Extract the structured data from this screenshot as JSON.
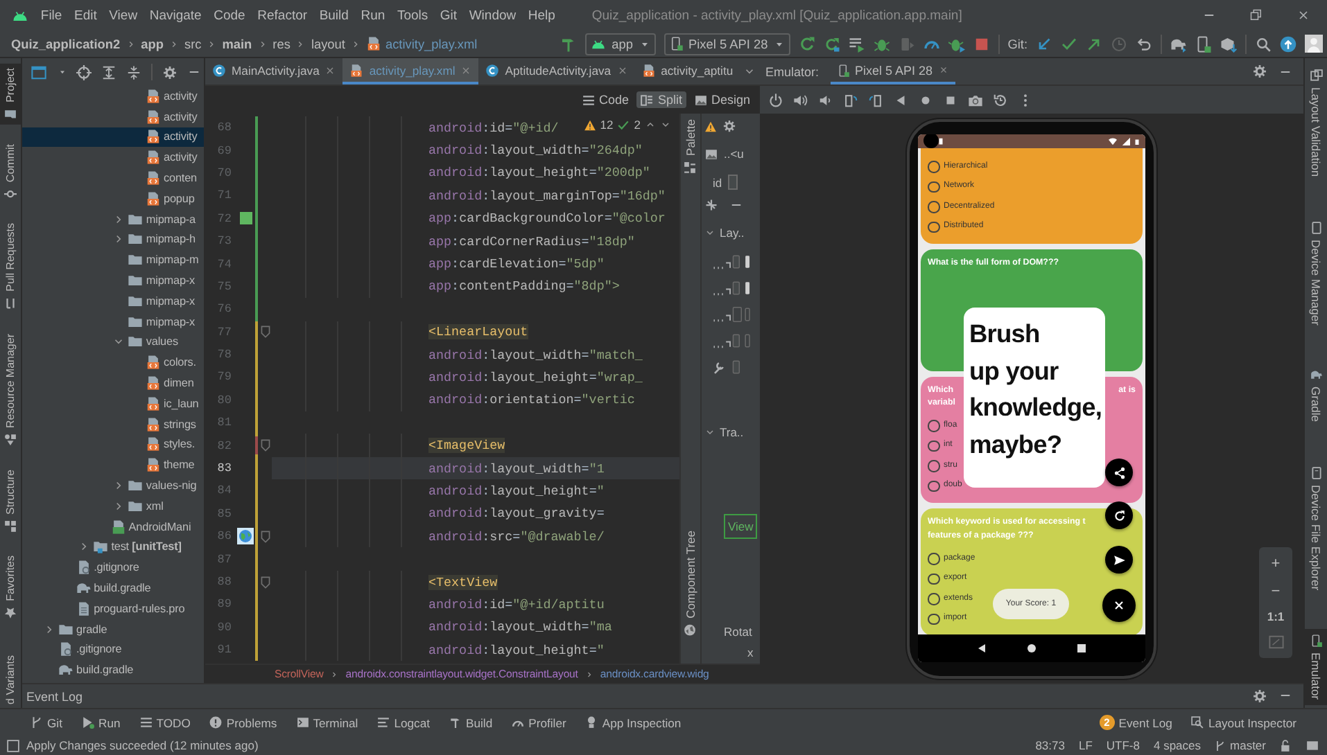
{
  "menu": {
    "items": [
      "File",
      "Edit",
      "View",
      "Navigate",
      "Code",
      "Refactor",
      "Build",
      "Run",
      "Tools",
      "Git",
      "Window",
      "Help"
    ],
    "title": "Quiz_application - activity_play.xml [Quiz_application.app.main]"
  },
  "breadcrumb": [
    {
      "label": "Quiz_application2",
      "kind": "module"
    },
    {
      "label": "app",
      "kind": "module"
    },
    {
      "label": "src",
      "kind": "dir"
    },
    {
      "label": "main",
      "kind": "module"
    },
    {
      "label": "res",
      "kind": "dir"
    },
    {
      "label": "layout",
      "kind": "dir"
    },
    {
      "label": "activity_play.xml",
      "kind": "file"
    }
  ],
  "toolbar": {
    "run_config": "app",
    "device": "Pixel 5 API 28",
    "git_label": "Git:"
  },
  "left_strip": [
    {
      "label": "Project",
      "kind": "project",
      "selected": true
    },
    {
      "label": "Commit",
      "kind": "commit",
      "selected": false
    },
    {
      "label": "Pull Requests",
      "kind": "pull",
      "selected": false
    },
    {
      "label": "Resource Manager",
      "kind": "resources",
      "selected": false
    },
    {
      "label": "Structure",
      "kind": "structure",
      "selected": false
    },
    {
      "label": "Favorites",
      "kind": "favorites",
      "selected": false
    },
    {
      "label": "d Variants",
      "kind": "cut",
      "selected": false
    }
  ],
  "project_tree": [
    {
      "children": [
        {
          "children": [
            {
              "children": [
                {
                  "children": [
                    {
                      "children": [
                        {
                          "label": "activity",
                          "kind": "xml",
                          "selected": false
                        },
                        {
                          "label": "activity",
                          "kind": "xml",
                          "selected": false
                        },
                        {
                          "label": "activity",
                          "kind": "xml",
                          "selected": true
                        },
                        {
                          "label": "activity",
                          "kind": "xml",
                          "selected": false
                        },
                        {
                          "label": "conten",
                          "kind": "xml",
                          "selected": false
                        },
                        {
                          "label": "popup",
                          "kind": "xml",
                          "selected": false
                        }
                      ]
                    },
                    {
                      "label": "mipmap-a",
                      "kind": "folder",
                      "expanded": false,
                      "selected": false
                    },
                    {
                      "label": "mipmap-h",
                      "kind": "folder",
                      "expanded": false,
                      "selected": false
                    },
                    {
                      "label": "mipmap-m",
                      "kind": "folder",
                      "selected": false
                    },
                    {
                      "label": "mipmap-x",
                      "kind": "folder",
                      "selected": false
                    },
                    {
                      "label": "mipmap-x",
                      "kind": "folder",
                      "selected": false
                    },
                    {
                      "label": "mipmap-x",
                      "kind": "folder",
                      "selected": false
                    },
                    {
                      "label": "values",
                      "kind": "folder",
                      "expanded": true,
                      "selected": false,
                      "children": [
                        {
                          "label": "colors.",
                          "kind": "xml",
                          "selected": false
                        },
                        {
                          "label": "dimen",
                          "kind": "xml",
                          "selected": false
                        },
                        {
                          "label": "ic_laun",
                          "kind": "xml",
                          "selected": false
                        },
                        {
                          "label": "strings",
                          "kind": "xml",
                          "selected": false
                        },
                        {
                          "label": "styles.",
                          "kind": "xml",
                          "selected": false
                        },
                        {
                          "label": "theme",
                          "kind": "xml",
                          "selected": false
                        }
                      ]
                    },
                    {
                      "label": "values-nig",
                      "kind": "folder",
                      "expanded": false,
                      "selected": false
                    },
                    {
                      "label": "xml",
                      "kind": "folder",
                      "expanded": false,
                      "selected": false
                    }
                  ]
                },
                {
                  "label": "AndroidMani",
                  "kind": "manifest",
                  "selected": false
                }
              ]
            },
            {
              "label": "test **[unitTest]**",
              "kind": "test-folder",
              "expanded": false,
              "selected": false
            }
          ]
        },
        {
          "label": ".gitignore",
          "kind": "ignore",
          "selected": false
        },
        {
          "label": "build.gradle",
          "kind": "gradle",
          "selected": false
        },
        {
          "label": "proguard-rules.pro",
          "kind": "text",
          "selected": false
        }
      ]
    },
    {
      "label": "gradle",
      "kind": "folder",
      "expanded": false,
      "selected": false
    },
    {
      "label": ".gitignore",
      "kind": "ignore",
      "selected": false
    },
    {
      "label": "build.gradle",
      "kind": "gradle",
      "selected": false
    }
  ],
  "editor": {
    "tabs": [
      {
        "label": "MainActivity.java",
        "kind": "java",
        "modified": false,
        "selected": false
      },
      {
        "label": "activity_play.xml",
        "kind": "xml",
        "modified": true,
        "selected": true
      },
      {
        "label": "AptitudeActivity.java",
        "kind": "java",
        "modified": false,
        "selected": false
      }
    ],
    "overflow_tab": {
      "label": "activity_aptitu",
      "kind": "xml"
    },
    "view_modes": [
      {
        "label": "Code",
        "kind": "code",
        "selected": false
      },
      {
        "label": "Split",
        "kind": "split",
        "selected": true
      },
      {
        "label": "Design",
        "kind": "design",
        "selected": false
      }
    ],
    "inspections": {
      "warnings": "12",
      "passed": "2"
    },
    "lines": [
      {
        "number": "68",
        "code": "android:id=\"@+id/",
        "added": true,
        "flagged": false,
        "current": false,
        "fold": false,
        "preview": false
      },
      {
        "number": "69",
        "code": "android:layout_width=\"264dp\"",
        "added": true,
        "flagged": false,
        "current": false,
        "fold": false,
        "preview": false
      },
      {
        "number": "70",
        "code": "android:layout_height=\"200dp\"",
        "added": true,
        "flagged": false,
        "current": false,
        "fold": false,
        "preview": false
      },
      {
        "number": "71",
        "code": "android:layout_marginTop=\"16dp\"",
        "added": true,
        "flagged": false,
        "current": false,
        "fold": false,
        "preview": false
      },
      {
        "number": "72",
        "code": "app:cardBackgroundColor=\"@color",
        "added": true,
        "flagged": false,
        "current": false,
        "fold": false,
        "preview": false,
        "color": "#5fb760"
      },
      {
        "number": "73",
        "code": "app:cardCornerRadius=\"18dp\"",
        "added": true,
        "flagged": false,
        "current": false,
        "fold": false,
        "preview": false
      },
      {
        "number": "74",
        "code": "app:cardElevation=\"5dp\"",
        "added": true,
        "flagged": false,
        "current": false,
        "fold": false,
        "preview": false
      },
      {
        "number": "75",
        "code": "app:contentPadding=\"8dp\">",
        "added": true,
        "flagged": false,
        "current": false,
        "fold": false,
        "preview": false
      },
      {
        "number": "76",
        "added": true,
        "flagged": false,
        "current": false,
        "fold": false,
        "preview": false
      },
      {
        "number": "77",
        "code": "<LinearLayout",
        "added": false,
        "flagged": false,
        "current": false,
        "fold": true,
        "preview": false
      },
      {
        "number": "78",
        "code": "    android:layout_width=\"match_",
        "added": false,
        "flagged": false,
        "current": false,
        "fold": false,
        "preview": false
      },
      {
        "number": "79",
        "code": "    android:layout_height=\"wrap_",
        "added": false,
        "flagged": false,
        "current": false,
        "fold": false,
        "preview": false
      },
      {
        "number": "80",
        "code": "    android:orientation=\"vertic",
        "added": false,
        "flagged": false,
        "current": false,
        "fold": false,
        "preview": false
      },
      {
        "number": "81",
        "added": false,
        "flagged": false,
        "current": false,
        "fold": false,
        "preview": false
      },
      {
        "number": "82",
        "code": "    <ImageView",
        "added": false,
        "flagged": true,
        "current": false,
        "fold": true,
        "preview": false
      },
      {
        "number": "83",
        "code": "        android:layout_width=\"1",
        "added": false,
        "flagged": false,
        "current": true,
        "fold": false,
        "preview": false
      },
      {
        "number": "84",
        "code": "        android:layout_height=\"",
        "added": false,
        "flagged": false,
        "current": false,
        "fold": false,
        "preview": false
      },
      {
        "number": "85",
        "code": "        android:layout_gravity=",
        "added": false,
        "flagged": false,
        "current": false,
        "fold": false,
        "preview": false
      },
      {
        "number": "86",
        "code": "        android:src=\"@drawable/",
        "added": false,
        "flagged": false,
        "current": false,
        "fold": true,
        "preview": true
      },
      {
        "number": "87",
        "added": false,
        "flagged": false,
        "current": false,
        "fold": false,
        "preview": false
      },
      {
        "number": "88",
        "code": "    <TextView",
        "added": false,
        "flagged": false,
        "current": false,
        "fold": true,
        "preview": false
      },
      {
        "number": "89",
        "code": "        android:id=\"@+id/aptitu",
        "added": false,
        "flagged": false,
        "current": false,
        "fold": false,
        "preview": false
      },
      {
        "number": "90",
        "code": "        android:layout_width=\"ma",
        "added": false,
        "flagged": false,
        "current": false,
        "fold": false,
        "preview": false
      },
      {
        "number": "91",
        "code": "        android:layout_height=\"",
        "added": false,
        "flagged": false,
        "current": false,
        "fold": false,
        "preview": false
      }
    ],
    "path": [
      {
        "label": "ScrollView",
        "color": "#c3645a"
      },
      {
        "label": "androidx.constraintlayout.widget.ConstraintLayout",
        "color": "#a772c7"
      },
      {
        "label": "androidx.cardview.widg",
        "color": "#6a8fc4"
      }
    ]
  },
  "palette_label": "Palette",
  "component_tree_label": "Component Tree",
  "attributes": {
    "component": "..<u",
    "id_label": "id",
    "sections": [
      {
        "label": "Lay..",
        "expanded": true
      },
      {
        "label": "Tra..",
        "expanded": true
      }
    ],
    "preview": "View",
    "rotation_label": "Rotat",
    "axis_label": "x"
  },
  "emulator": {
    "label": "Emulator:",
    "device_tab": "Pixel 5 API 28",
    "zoom_in": "+",
    "zoom_out": "−",
    "actual_size": "1:1"
  },
  "phone": {
    "cards": [
      {
        "color": "#eb9e2c",
        "options": [
          {
            "label": "Hierarchical",
            "checked": false
          },
          {
            "label": "Network",
            "checked": false
          },
          {
            "label": "Decentralized",
            "checked": false
          },
          {
            "label": "Distributed",
            "checked": false
          }
        ]
      },
      {
        "color": "#49a54b",
        "title": [
          "What is the full form of DOM???"
        ]
      },
      {
        "color": "#e47fa2",
        "title": [
          "Which",
          "variabl"
        ],
        "title_right": "at is",
        "options": [
          {
            "label": "floa",
            "checked": false
          },
          {
            "label": "int",
            "checked": false
          },
          {
            "label": "stru",
            "checked": false
          },
          {
            "label": "doub",
            "checked": false
          }
        ]
      },
      {
        "color": "#c9d151",
        "title": [
          "Which keyword is used for accessing t",
          "features of a package ???"
        ],
        "options": [
          {
            "label": "package",
            "checked": false
          },
          {
            "label": "export",
            "checked": false
          },
          {
            "label": "extends",
            "checked": false
          },
          {
            "label": "import",
            "checked": false
          }
        ]
      }
    ],
    "popup": "Brush\nup your\nknowledge,\nmaybe?",
    "score": "Your Score: 1"
  },
  "right_strip": [
    {
      "label": "Layout Validation",
      "kind": "validation",
      "selected": false
    },
    {
      "label": "Device Manager",
      "kind": "devices",
      "selected": false
    },
    {
      "label": "Gradle",
      "kind": "gradle",
      "selected": false
    },
    {
      "label": "Device File Explorer",
      "kind": "files",
      "selected": false
    },
    {
      "label": "Emulator",
      "kind": "emulator",
      "selected": true
    }
  ],
  "event_log": {
    "title": "Event Log"
  },
  "tool_tabs": [
    {
      "label": "Git",
      "kind": "git"
    },
    {
      "label": "Run",
      "kind": "run"
    },
    {
      "label": "TODO",
      "kind": "todo"
    },
    {
      "label": "Problems",
      "kind": "problems"
    },
    {
      "label": "Terminal",
      "kind": "terminal"
    },
    {
      "label": "Logcat",
      "kind": "logcat"
    },
    {
      "label": "Build",
      "kind": "build"
    },
    {
      "label": "Profiler",
      "kind": "profiler"
    },
    {
      "label": "App Inspection",
      "kind": "inspection"
    }
  ],
  "right_tabs": [
    {
      "label": "Event Log",
      "badge": "2"
    },
    {
      "label": "Layout Inspector",
      "kind": "inspector"
    }
  ],
  "status": {
    "message": "Apply Changes succeeded (12 minutes ago)",
    "position": "83:73",
    "line_separator": "LF",
    "encoding": "UTF-8",
    "indent": "4 spaces",
    "branch": "master"
  }
}
